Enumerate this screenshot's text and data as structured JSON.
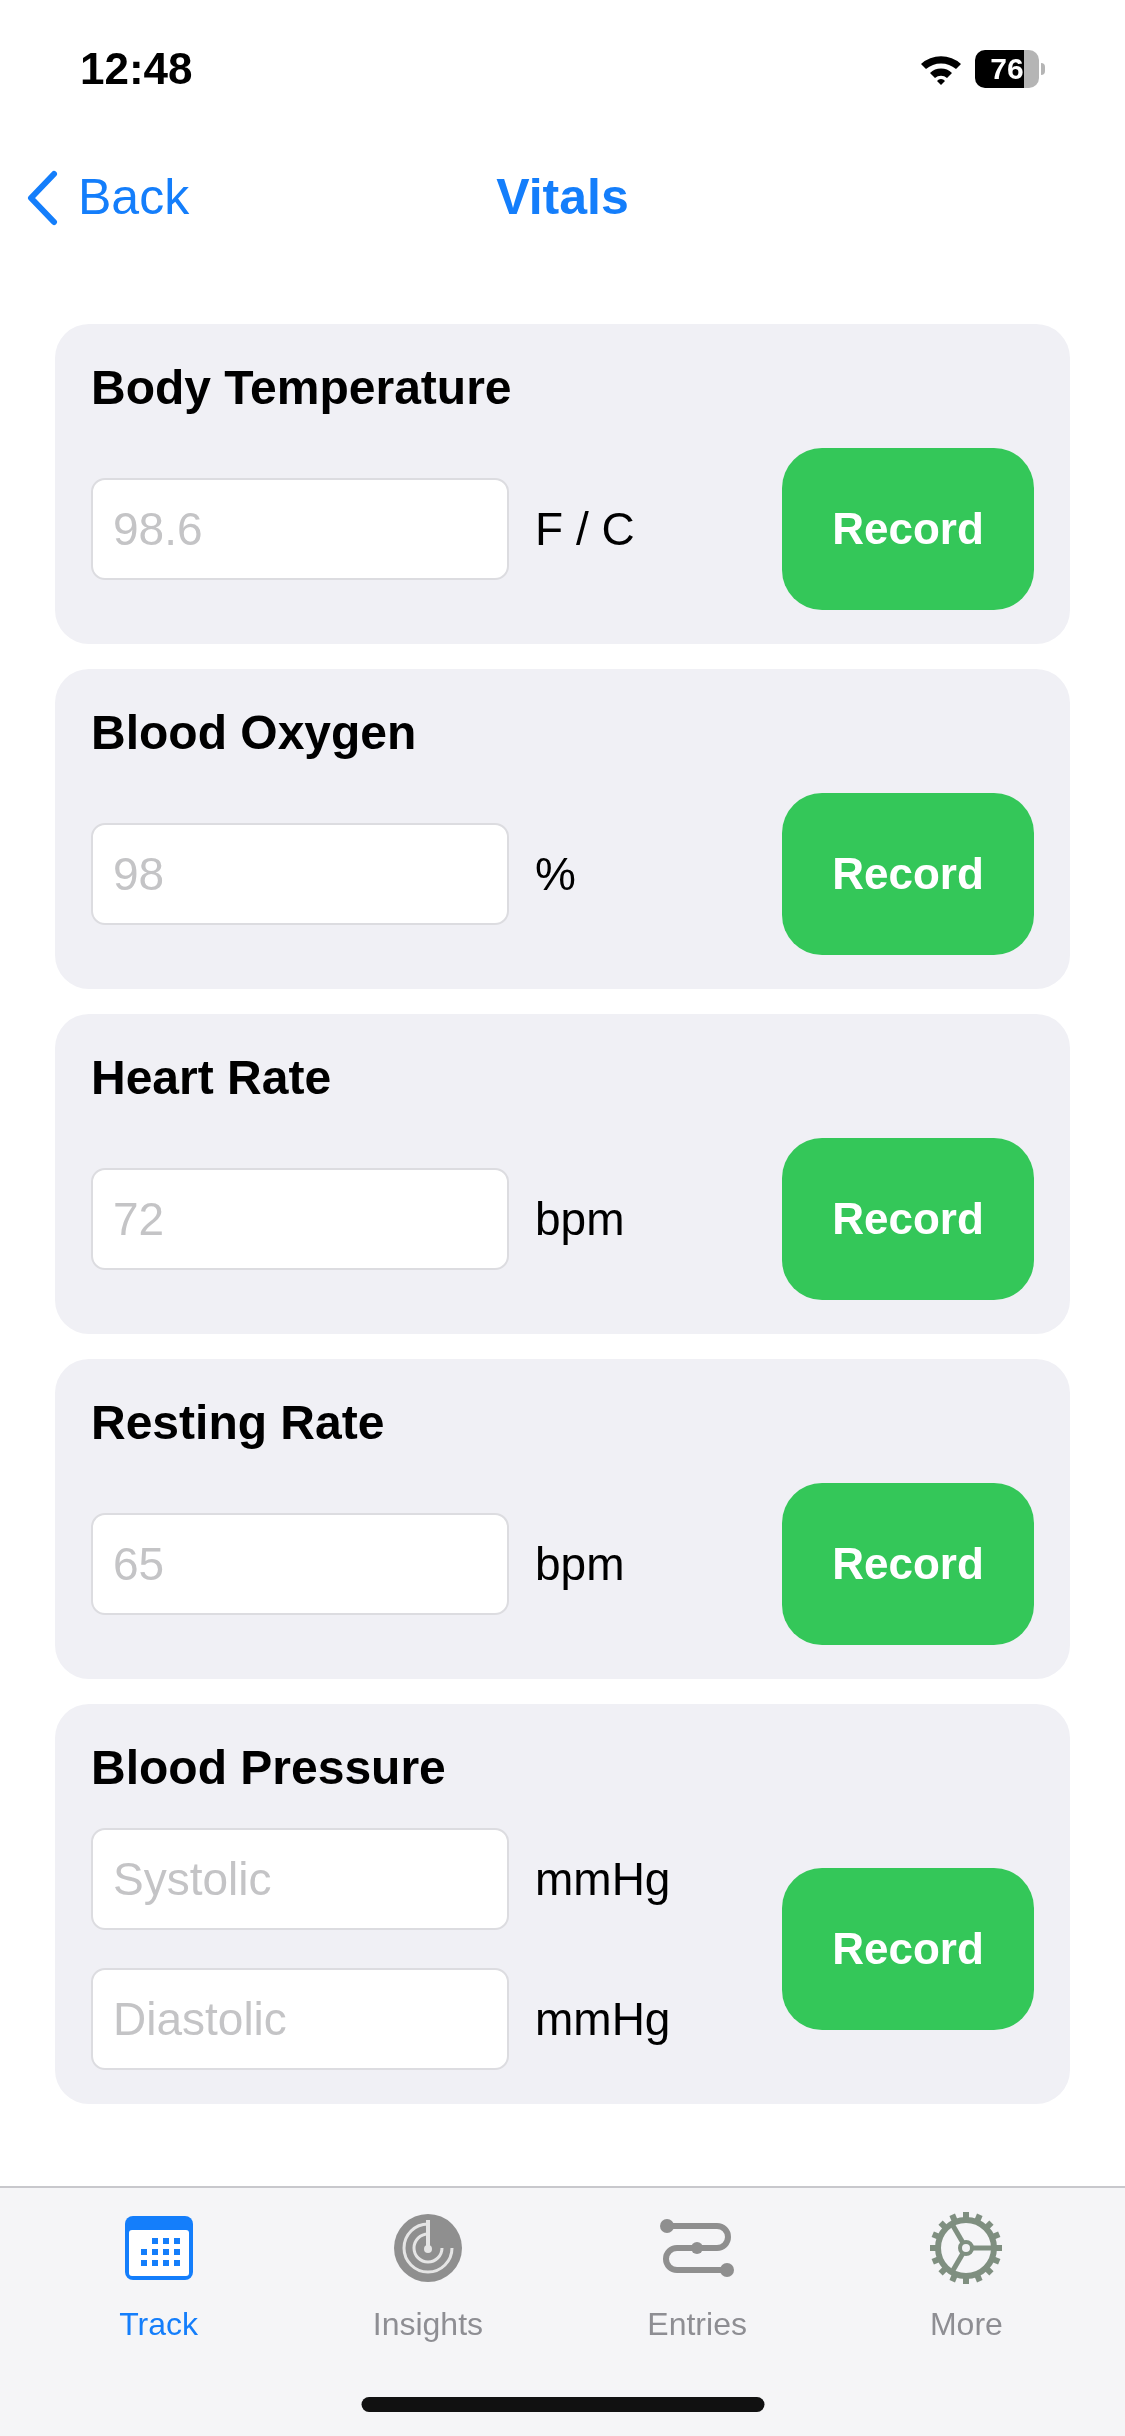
{
  "status_bar": {
    "time": "12:48",
    "battery": "76"
  },
  "nav": {
    "back": "Back",
    "title": "Vitals"
  },
  "cards": [
    {
      "title": "Body Temperature",
      "fields": [
        {
          "placeholder": "98.6",
          "unit": "F / C"
        }
      ],
      "button": "Record"
    },
    {
      "title": "Blood Oxygen",
      "fields": [
        {
          "placeholder": "98",
          "unit": "%"
        }
      ],
      "button": "Record"
    },
    {
      "title": "Heart Rate",
      "fields": [
        {
          "placeholder": "72",
          "unit": "bpm"
        }
      ],
      "button": "Record"
    },
    {
      "title": "Resting Rate",
      "fields": [
        {
          "placeholder": "65",
          "unit": "bpm"
        }
      ],
      "button": "Record"
    },
    {
      "title": "Blood Pressure",
      "fields": [
        {
          "placeholder": "Systolic",
          "unit": "mmHg"
        },
        {
          "placeholder": "Diastolic",
          "unit": "mmHg"
        }
      ],
      "button": "Record"
    }
  ],
  "tabs": [
    {
      "label": "Track",
      "kind": "calendar",
      "selected": true
    },
    {
      "label": "Insights",
      "kind": "gauge",
      "selected": false
    },
    {
      "label": "Entries",
      "kind": "route",
      "selected": false
    },
    {
      "label": "More",
      "kind": "gear",
      "selected": false
    }
  ]
}
